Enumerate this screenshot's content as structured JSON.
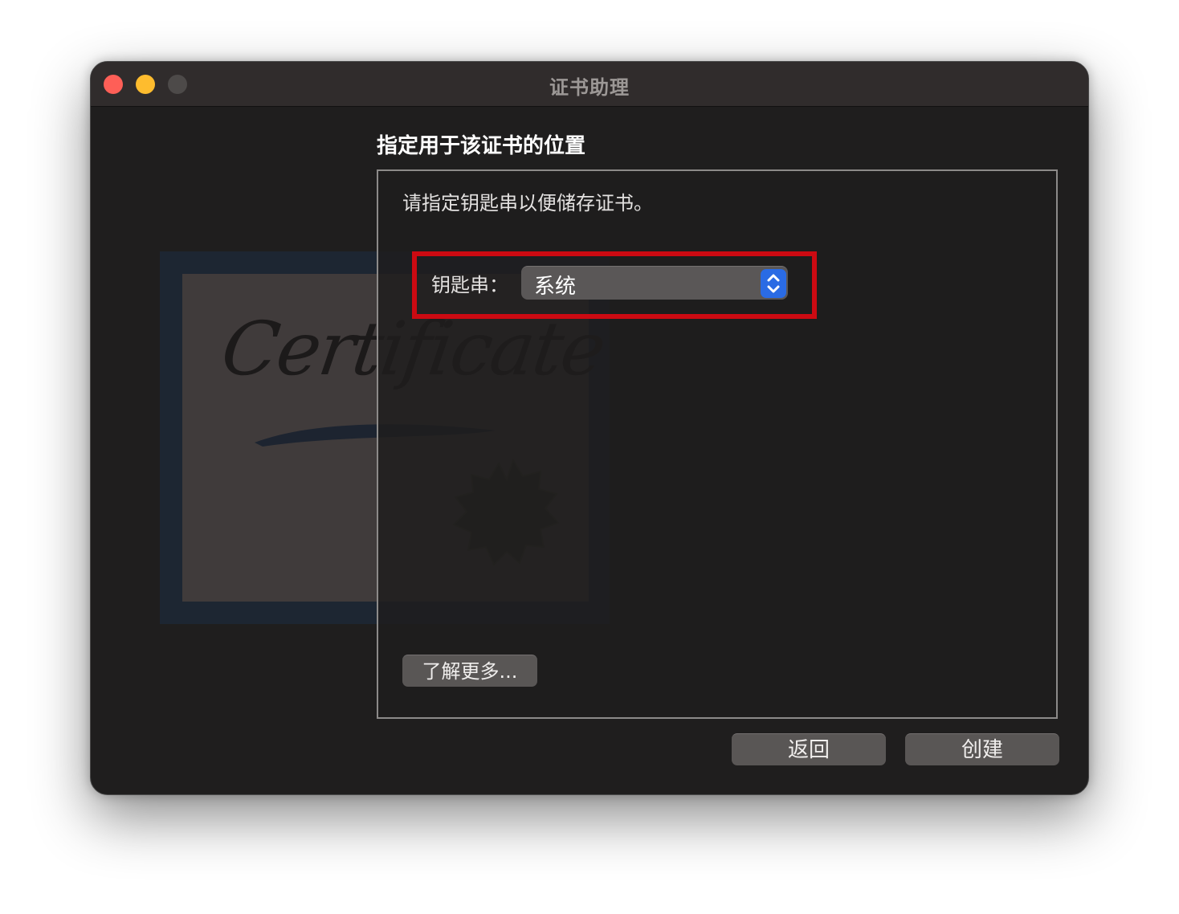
{
  "window": {
    "title": "证书助理"
  },
  "heading": "指定用于该证书的位置",
  "instruction": "请指定钥匙串以便储存证书。",
  "keychain": {
    "label": "钥匙串：",
    "selected_value": "系统"
  },
  "learn_more_label": "了解更多...",
  "buttons": {
    "back_label": "返回",
    "create_label": "创建"
  },
  "illustration": {
    "word": "Certificate"
  },
  "colors": {
    "highlight": "#cc0a12",
    "popup_accent": "#2a6be4",
    "close": "#fe5f57",
    "minimize": "#febc2e"
  },
  "icons": [
    "close-button",
    "minimize-button",
    "zoom-button",
    "chevron-up-down-icon",
    "certificate-illustration"
  ]
}
